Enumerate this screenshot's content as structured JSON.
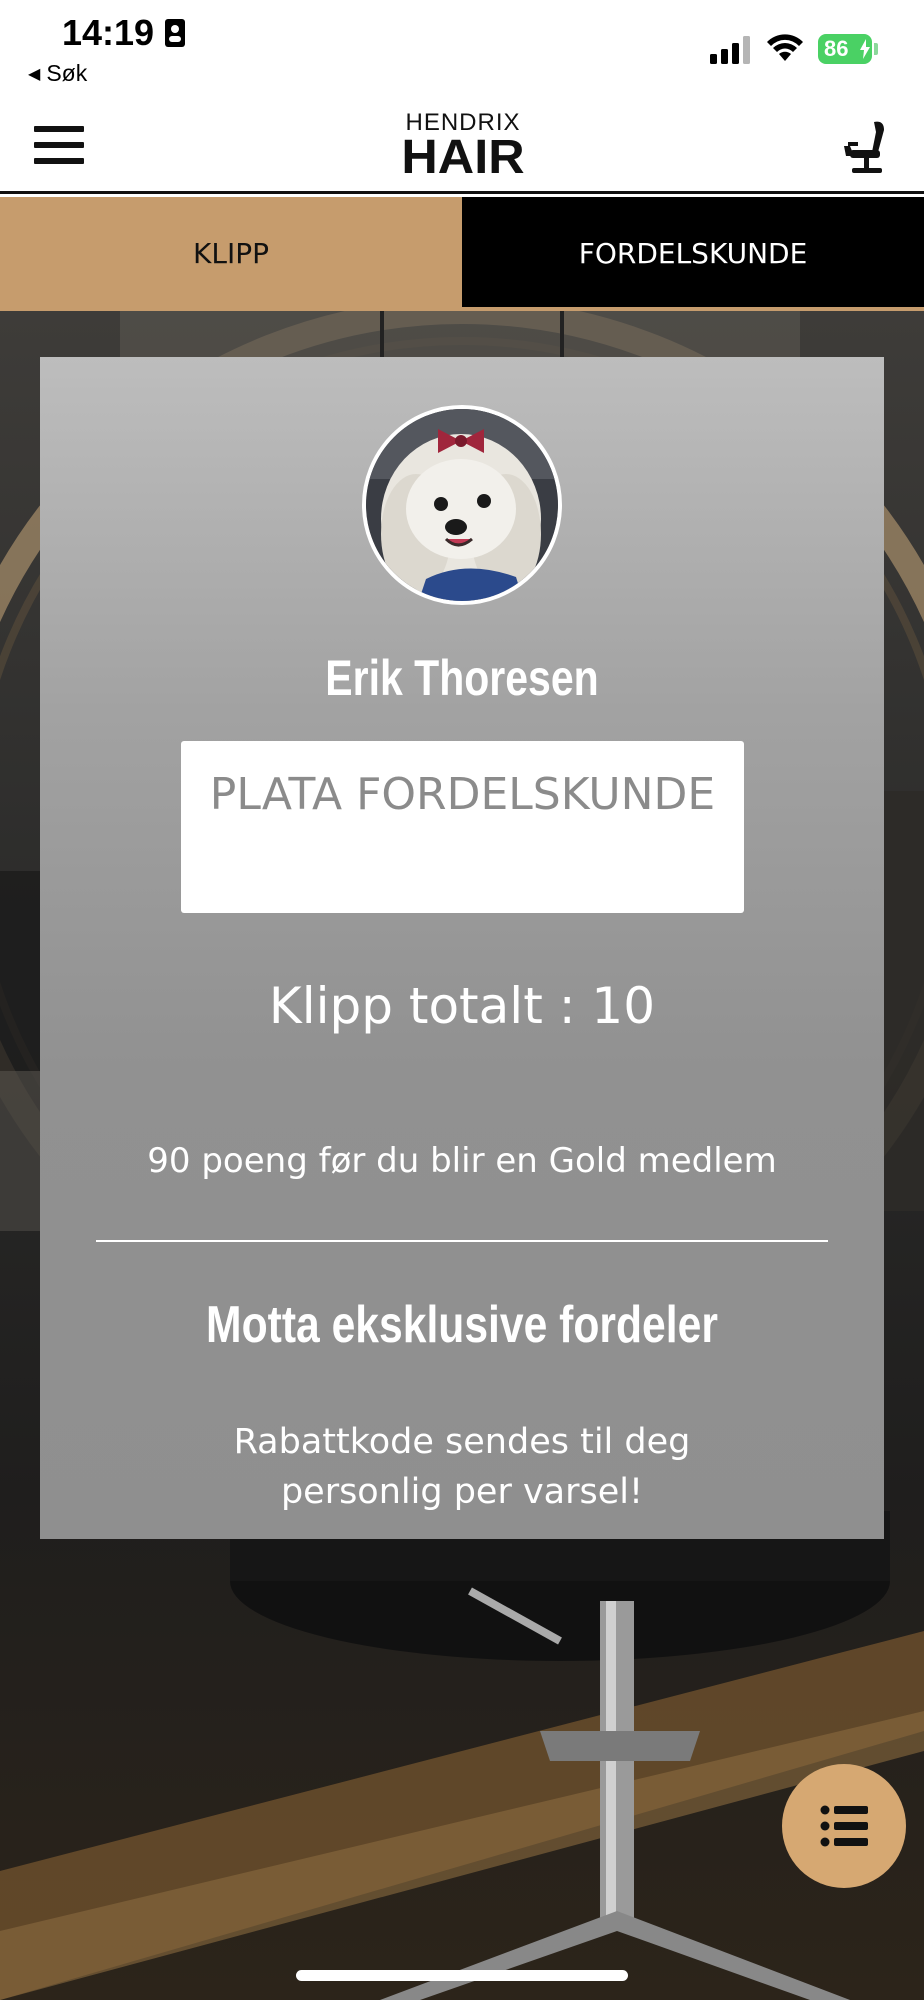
{
  "status_bar": {
    "time": "14:19",
    "back_label": "Søk",
    "battery": "86",
    "icons": [
      "person-id-icon",
      "signal-icon",
      "wifi-icon",
      "battery-icon"
    ]
  },
  "header": {
    "logo_top": "HENDRIX",
    "logo_bottom": "HAIR",
    "icons": [
      "menu-icon",
      "barber-chair-icon"
    ]
  },
  "tabs": [
    {
      "label": "KLIPP",
      "active": true
    },
    {
      "label": "FORDELSKUNDE",
      "active": false
    }
  ],
  "card": {
    "name": "Erik Thoresen",
    "membership": "PLATA FORDELSKUNDE",
    "visits": "Klipp totalt : 10",
    "points_info": "90 poeng før du blir en Gold medlem",
    "benefits_heading": "Motta eksklusive fordeler",
    "benefits_text": "Rabattkode sendes til deg personlig per varsel!"
  },
  "fab": {
    "icon": "list-icon"
  },
  "colors": {
    "accent": "#c69c6d",
    "fab": "#d6a872",
    "tab_inactive_bg": "#000000",
    "battery": "#4ad164",
    "card_top": "#bdbdbd",
    "card_bottom": "#8f8f8f"
  }
}
